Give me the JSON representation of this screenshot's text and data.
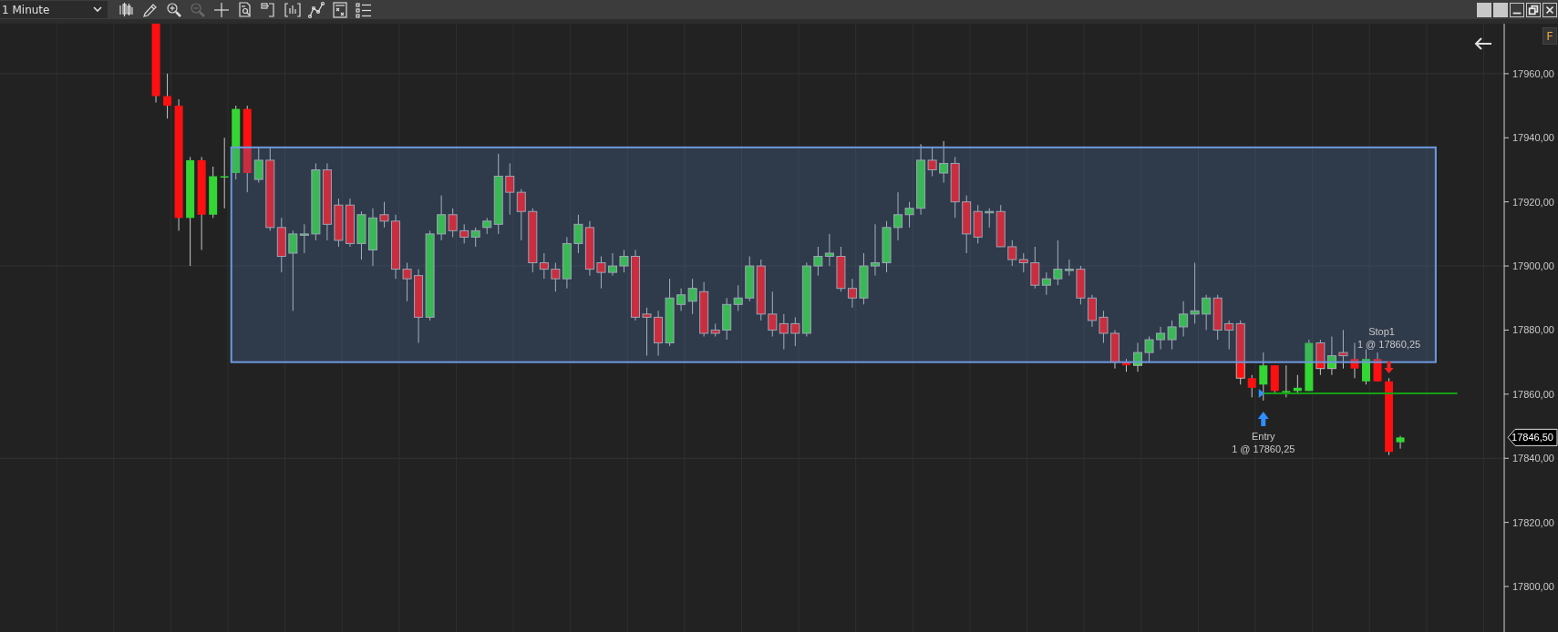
{
  "toolbar": {
    "interval": "1 Minute",
    "tools": [
      {
        "disabled": false
      },
      {
        "disabled": false
      },
      {
        "disabled": false
      },
      {
        "disabled": true
      },
      {
        "disabled": false
      },
      {
        "disabled": false
      },
      {
        "disabled": false
      },
      {
        "disabled": false
      },
      {
        "disabled": false
      },
      {
        "disabled": false
      },
      {
        "disabled": false
      }
    ]
  },
  "badge": "F",
  "price_axis": {
    "labels": [
      "17960,00",
      "17940,00",
      "17920,00",
      "17900,00",
      "17880,00",
      "17860,00",
      "17840,00",
      "17820,00",
      "17800,00"
    ]
  },
  "trades": [
    {
      "kind": "entry",
      "label": "Entry",
      "detail": "1 @ 17860,25"
    },
    {
      "kind": "stop",
      "label": "Stop1",
      "detail": "1 @ 17860,25"
    }
  ],
  "last_price": "17846,50"
}
